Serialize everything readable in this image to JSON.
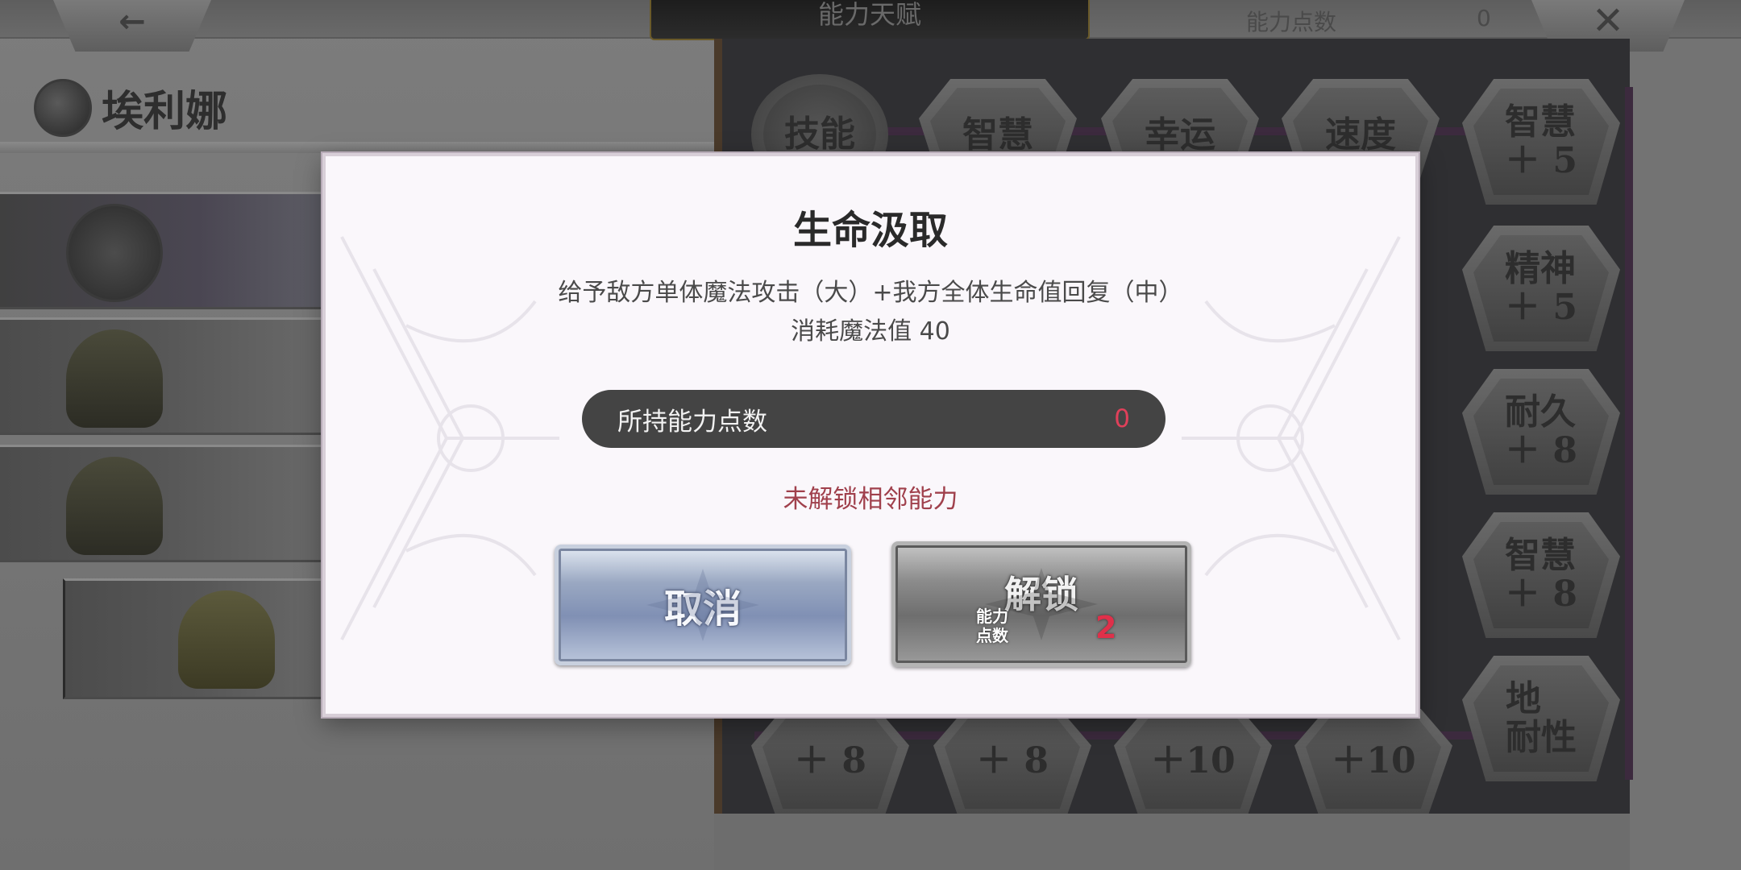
{
  "topbar": {
    "back_glyph": "←",
    "tab_title": "能力天赋",
    "points_label": "能力点数",
    "points_value": "0",
    "close_glyph": "✕"
  },
  "character": {
    "name": "埃利娜"
  },
  "board": {
    "nodes": [
      {
        "label": "技能"
      },
      {
        "label": "智慧"
      },
      {
        "label": "幸运"
      },
      {
        "label": "速度"
      },
      {
        "label": "智慧\n＋ 5"
      },
      {
        "label": "精神\n＋ 5"
      },
      {
        "label": "耐久\n＋ 8"
      },
      {
        "label": "智慧\n＋ 8"
      },
      {
        "label": "地\n耐性"
      },
      {
        "label": "＋ 8"
      },
      {
        "label": "＋ 8"
      },
      {
        "label": "＋10"
      },
      {
        "label": "＋10"
      }
    ]
  },
  "dialog": {
    "title": "生命汲取",
    "description": "给予敌方单体魔法攻击（大）+我方全体生命值回复（中）",
    "cost": "消耗魔法值 40",
    "held_points_label": "所持能力点数",
    "held_points_value": "0",
    "locked_note": "未解锁相邻能力",
    "cancel_label": "取消",
    "unlock_label": "解锁",
    "unlock_cost_label_line1": "能力",
    "unlock_cost_label_line2": "点数",
    "unlock_cost_value": "2"
  },
  "colors": {
    "dialog_bg": "#faf7fb",
    "points_value": "#e0405a",
    "locked_note": "#a0404c",
    "cancel_button": "#8090b4",
    "unlock_button": "#8c8c8c"
  }
}
